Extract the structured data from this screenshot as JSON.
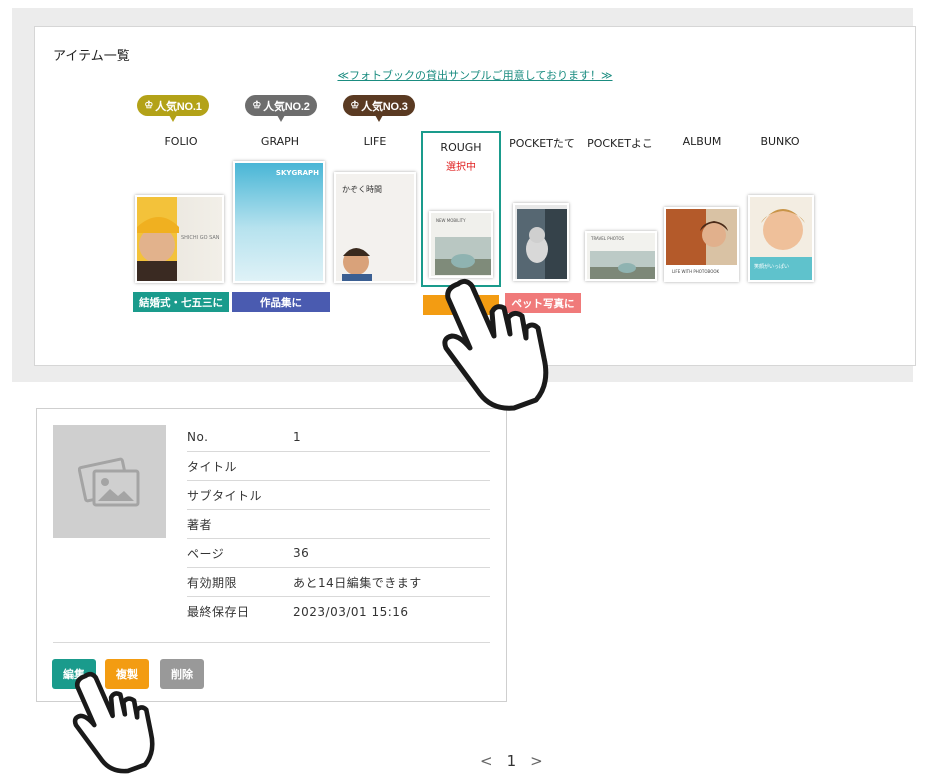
{
  "panel": {
    "title": "アイテム一覧",
    "sample_link": "≪フォトブックの貸出サンプルご用意しております！≫"
  },
  "rank_badges": [
    {
      "crown": "♔",
      "label": "人気NO.1",
      "color": "#b3a218"
    },
    {
      "crown": "♔",
      "label": "人気NO.2",
      "color": "#6d6d6d"
    },
    {
      "crown": "♔",
      "label": "人気NO.3",
      "color": "#5a3a22"
    }
  ],
  "products": [
    {
      "name": "FOLIO"
    },
    {
      "name": "GRAPH"
    },
    {
      "name": "LIFE"
    },
    {
      "name": "ROUGH",
      "selected_label": "選択中"
    },
    {
      "name": "POCKETたて"
    },
    {
      "name": "POCKETよこ"
    },
    {
      "name": "ALBUM"
    },
    {
      "name": "BUNKO"
    }
  ],
  "covers": {
    "folio_text": "SHICHI GO SAN",
    "graph_text": "SKYGRAPH",
    "life_text": "かぞく時間",
    "rough_text": "NEW MOBILITY",
    "pocketyoko_text": "TRAVEL PHOTOS",
    "album_text": "LIFE WITH PHOTOBOOK",
    "bunko_text": "笑顔がいっぱい"
  },
  "tags": [
    {
      "label": "結婚式・七五三に",
      "color": "#1a9b8c"
    },
    {
      "label": "作品集に",
      "color": "#4a5bb0"
    },
    {
      "label": "家族",
      "color": "#f39c12"
    },
    {
      "label": "ペット写真に",
      "color": "#f07a7a"
    }
  ],
  "book": {
    "rows": [
      {
        "label": "No.",
        "value": "1"
      },
      {
        "label": "タイトル",
        "value": ""
      },
      {
        "label": "サブタイトル",
        "value": ""
      },
      {
        "label": "著者",
        "value": ""
      },
      {
        "label": "ページ",
        "value": "36"
      },
      {
        "label": "有効期限",
        "value": "あと14日編集できます"
      },
      {
        "label": "最終保存日",
        "value": "2023/03/01 15:16"
      }
    ],
    "buttons": {
      "edit": "編集",
      "copy": "複製",
      "delete": "削除"
    },
    "thumbnail_icon": "image-placeholder-icon"
  },
  "pagination": {
    "prev": "<",
    "current": "1",
    "next": ">"
  }
}
